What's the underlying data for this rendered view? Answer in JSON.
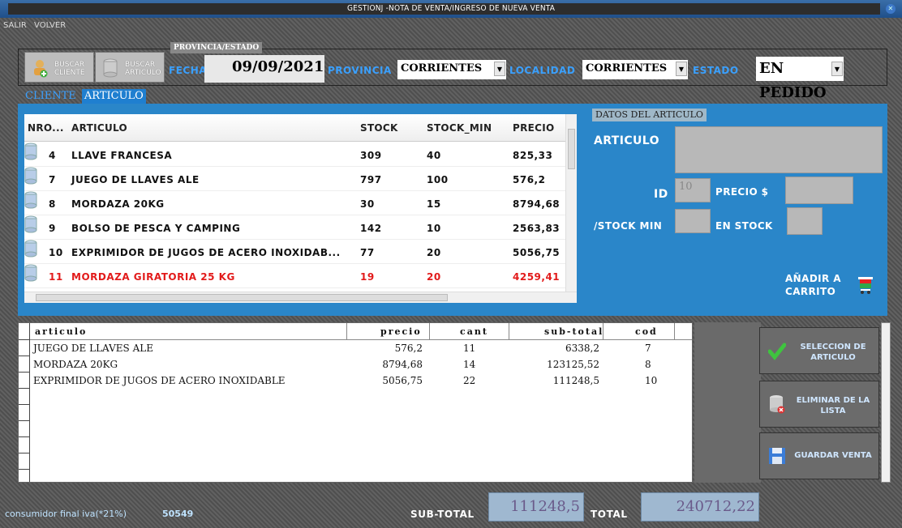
{
  "window": {
    "title": "GESTIONJ -NOTA DE VENTA/INGRESO DE NUEVA VENTA"
  },
  "menu": {
    "items": [
      "SALIR",
      "VOLVER"
    ]
  },
  "toolbar": {
    "buscar_cliente": "BUSCAR CLIENTE",
    "buscar_articulo": "BUSCAR ARTICULO",
    "group_tag": "PROVINCIA/ESTADO",
    "fecha_label": "FECHA",
    "fecha_value": "09/09/2021",
    "provincia_label": "PROVINCIA",
    "provincia_value": "CORRIENTES",
    "localidad_label": "LOCALIDAD",
    "localidad_value": "CORRIENTES",
    "estado_label": "ESTADO",
    "estado_value": "EN PEDIDO"
  },
  "tabs": [
    {
      "label": "CLIENTE",
      "active": false
    },
    {
      "label": "ARTICULO",
      "active": true
    }
  ],
  "articles_grid": {
    "headers": [
      "NRO...",
      "ARTICULO",
      "STOCK",
      "STOCK_MIN",
      "PRECIO"
    ],
    "rows": [
      {
        "nro": "4",
        "articulo": "LLAVE FRANCESA",
        "stock": "309",
        "stock_min": "40",
        "precio": "825,33",
        "alert": false
      },
      {
        "nro": "7",
        "articulo": "JUEGO DE LLAVES ALE",
        "stock": "797",
        "stock_min": "100",
        "precio": "576,2",
        "alert": false
      },
      {
        "nro": "8",
        "articulo": "MORDAZA 20KG",
        "stock": "30",
        "stock_min": "15",
        "precio": "8794,68",
        "alert": false
      },
      {
        "nro": "9",
        "articulo": "BOLSO DE PESCA Y CAMPING",
        "stock": "142",
        "stock_min": "10",
        "precio": "2563,83",
        "alert": false
      },
      {
        "nro": "10",
        "articulo": "EXPRIMIDOR DE JUGOS DE ACERO INOXIDAB...",
        "stock": "77",
        "stock_min": "20",
        "precio": "5056,75",
        "alert": false
      },
      {
        "nro": "11",
        "articulo": "MORDAZA GIRATORIA 25 KG",
        "stock": "19",
        "stock_min": "20",
        "precio": "4259,41",
        "alert": true
      }
    ]
  },
  "details": {
    "tag": "DATOS DEL ARTICULO",
    "articulo_label": "ARTICULO",
    "id_label": "ID",
    "id_value": "10",
    "precio_label": "PRECIO $",
    "stock_min_label": "/STOCK MIN",
    "en_stock_label": "EN STOCK",
    "add_cart_label": "AÑADIR A CARRITO"
  },
  "sale_list": {
    "headers": [
      "articulo",
      "precio",
      "cant",
      "sub-total",
      "cod"
    ],
    "rows": [
      {
        "articulo": "JUEGO DE LLAVES ALE",
        "precio": "576,2",
        "cant": "11",
        "subtotal": "6338,2",
        "cod": "7"
      },
      {
        "articulo": "MORDAZA 20KG",
        "precio": "8794,68",
        "cant": "14",
        "subtotal": "123125,52",
        "cod": "8"
      },
      {
        "articulo": "EXPRIMIDOR DE JUGOS DE ACERO INOXIDABLE",
        "precio": "5056,75",
        "cant": "22",
        "subtotal": "111248,5",
        "cod": "10"
      }
    ]
  },
  "actions": {
    "seleccion": "SELECCION DE ARTICULO",
    "eliminar": "ELIMINAR DE LA LISTA",
    "guardar": "GUARDAR VENTA"
  },
  "footer": {
    "client_info": "consumidor final iva(*21%)",
    "client_code": "50549",
    "subtotal_label": "SUB-TOTAL",
    "subtotal_value": "111248,5",
    "total_label": "TOTAL",
    "total_value": "240712,22"
  },
  "colors": {
    "accent_blue": "#2a86c9",
    "alert_red": "#e21b1b",
    "label_blue": "#3aa0ff"
  }
}
